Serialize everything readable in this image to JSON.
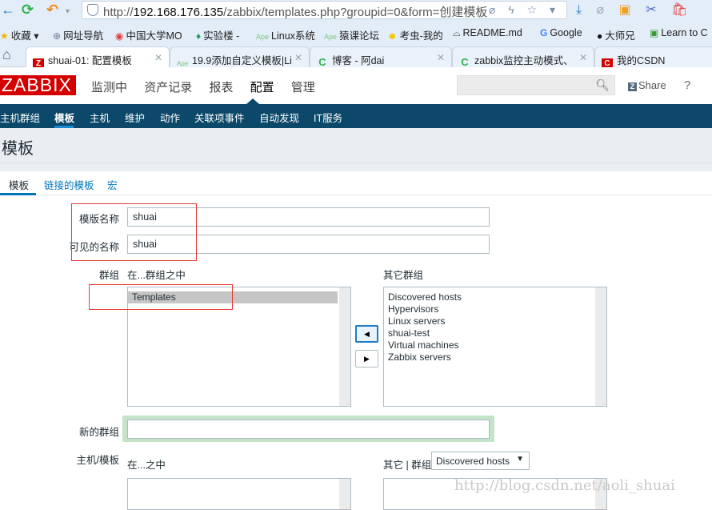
{
  "browser": {
    "url_prefix": "http://",
    "url_host": "192.168.176.135",
    "url_path": "/zabbix/templates.php?groupid=0&form=创建模板",
    "url_icons": "⌀ ϟ ☆ ▾",
    "bookmarks": [
      {
        "icon": "★",
        "label": "收藏 ▾"
      },
      {
        "icon": "⊕",
        "label": "网址导航"
      },
      {
        "icon": "◉",
        "label": "中国大学MO"
      },
      {
        "icon": "♦",
        "label": "实验楼 -"
      },
      {
        "icon": "Ape",
        "label": "Linux系统"
      },
      {
        "icon": "Ape",
        "label": "猿课论坛"
      },
      {
        "icon": "☻",
        "label": "考虫-我的"
      },
      {
        "icon": "⌓",
        "label": "README.md"
      },
      {
        "icon": "G",
        "label": "Google"
      },
      {
        "icon": "●",
        "label": "大师兄"
      },
      {
        "icon": "▣",
        "label": "Learn to C"
      }
    ],
    "tabs": [
      {
        "icon": "Z",
        "label": "shuai-01: 配置模板",
        "active": true
      },
      {
        "icon": "Ape",
        "label": "19.9添加自定义模板|Li",
        "active": false
      },
      {
        "icon": "C",
        "label": "博客 - 阿dai",
        "active": false
      },
      {
        "icon": "C",
        "label": "zabbix监控主动模式、",
        "active": false
      },
      {
        "icon": "C",
        "label": "我的CSDN",
        "active": false
      }
    ]
  },
  "zabbix": {
    "logo": "ZABBIX",
    "top_menu": [
      "监测中",
      "资产记录",
      "报表",
      "配置",
      "管理"
    ],
    "top_menu_active": "配置",
    "search_placeholder": "",
    "share_label": "Share",
    "help_label": "?",
    "sub_menu": [
      "主机群组",
      "模板",
      "主机",
      "维护",
      "动作",
      "关联项事件",
      "自动发现",
      "IT服务"
    ],
    "sub_menu_active": "模板",
    "page_title": "模板",
    "form_tabs": [
      "模板",
      "链接的模板",
      "宏"
    ],
    "form_tab_active": "模板"
  },
  "form": {
    "template_name_label": "模版名称",
    "template_name_value": "shuai",
    "visible_name_label": "可见的名称",
    "visible_name_value": "shuai",
    "groups_label": "群组",
    "in_groups_label": "在...群组之中",
    "in_groups": [
      "Templates"
    ],
    "other_groups_label": "其它群组",
    "other_groups": [
      "Discovered hosts",
      "Hypervisors",
      "Linux servers",
      "shuai-test",
      "Virtual machines",
      "Zabbix servers"
    ],
    "move_left_label": "◀",
    "move_right_label": "▶",
    "new_group_label": "新的群组",
    "new_group_value": "",
    "hosts_templates_label": "主机/模板",
    "in_label": "在...之中",
    "other_group_label": "其它 | 群组",
    "other_group_select": "Discovered hosts"
  },
  "watermark": "http://blog.csdn.net/aoli_shuai"
}
